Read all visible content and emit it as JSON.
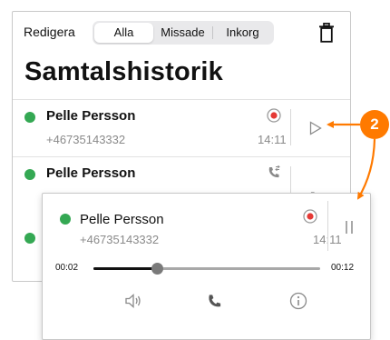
{
  "header": {
    "edit_label": "Redigera",
    "tabs": [
      "Alla",
      "Missade",
      "Inkorg"
    ],
    "active_tab": "Alla",
    "title": "Samtalshistorik"
  },
  "calls": [
    {
      "name": "Pelle Persson",
      "number": "+46735143332",
      "time": "14:11",
      "type_icon": "record-icon",
      "action_icon": "play-icon"
    },
    {
      "name": "Pelle Persson",
      "type_icon": "phone-transfer-icon",
      "action_icon": "phone-icon"
    }
  ],
  "player": {
    "name": "Pelle Persson",
    "number": "+46735143332",
    "time": "14:11",
    "elapsed": "00:02",
    "duration": "00:12",
    "progress": 0.28,
    "controls": [
      "speaker-icon",
      "phone-icon",
      "info-icon"
    ],
    "action_icon": "pause-icon"
  },
  "callout": {
    "badge": "2"
  },
  "colors": {
    "status_green": "#34a853",
    "record_red": "#e53935",
    "callout_orange": "#ff7a00"
  }
}
